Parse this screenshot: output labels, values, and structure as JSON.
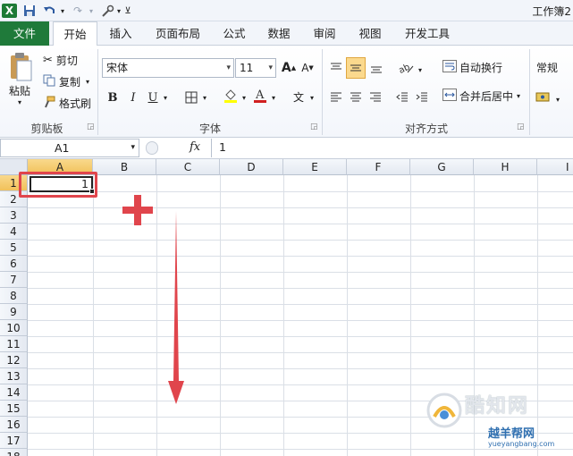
{
  "title_bar": {
    "doc_title": "工作簿2"
  },
  "tabs": [
    "文件",
    "开始",
    "插入",
    "页面布局",
    "公式",
    "数据",
    "审阅",
    "视图",
    "开发工具"
  ],
  "ribbon": {
    "clipboard": {
      "paste": "粘贴",
      "cut": "剪切",
      "copy": "复制",
      "format_painter": "格式刷",
      "label": "剪贴板"
    },
    "font": {
      "name": "宋体",
      "size": "11",
      "label": "字体",
      "bold": "B",
      "italic": "I",
      "underline": "U",
      "grow": "A",
      "shrink": "A",
      "phonetic": "文"
    },
    "alignment": {
      "wrap": "自动换行",
      "merge": "合并后居中",
      "label": "对齐方式"
    },
    "number": {
      "format": "常规"
    }
  },
  "formula_bar": {
    "name_box": "A1",
    "fx": "fx",
    "content": "1"
  },
  "columns": [
    "A",
    "B",
    "C",
    "D",
    "E",
    "F",
    "G",
    "H",
    "I"
  ],
  "rows": [
    "1",
    "2",
    "3",
    "4",
    "5",
    "6",
    "7",
    "8",
    "9",
    "10",
    "11",
    "12",
    "13",
    "14",
    "15",
    "16",
    "17",
    "18"
  ],
  "cells": {
    "A1": "1"
  },
  "watermark": {
    "brand": "酷知网",
    "site": "yueyangbang.com",
    "site_title": "越羊帮网"
  },
  "colors": {
    "accent_red": "#e0454c",
    "file_tab": "#1f7a3a",
    "selected_header": "#f1c15a"
  }
}
